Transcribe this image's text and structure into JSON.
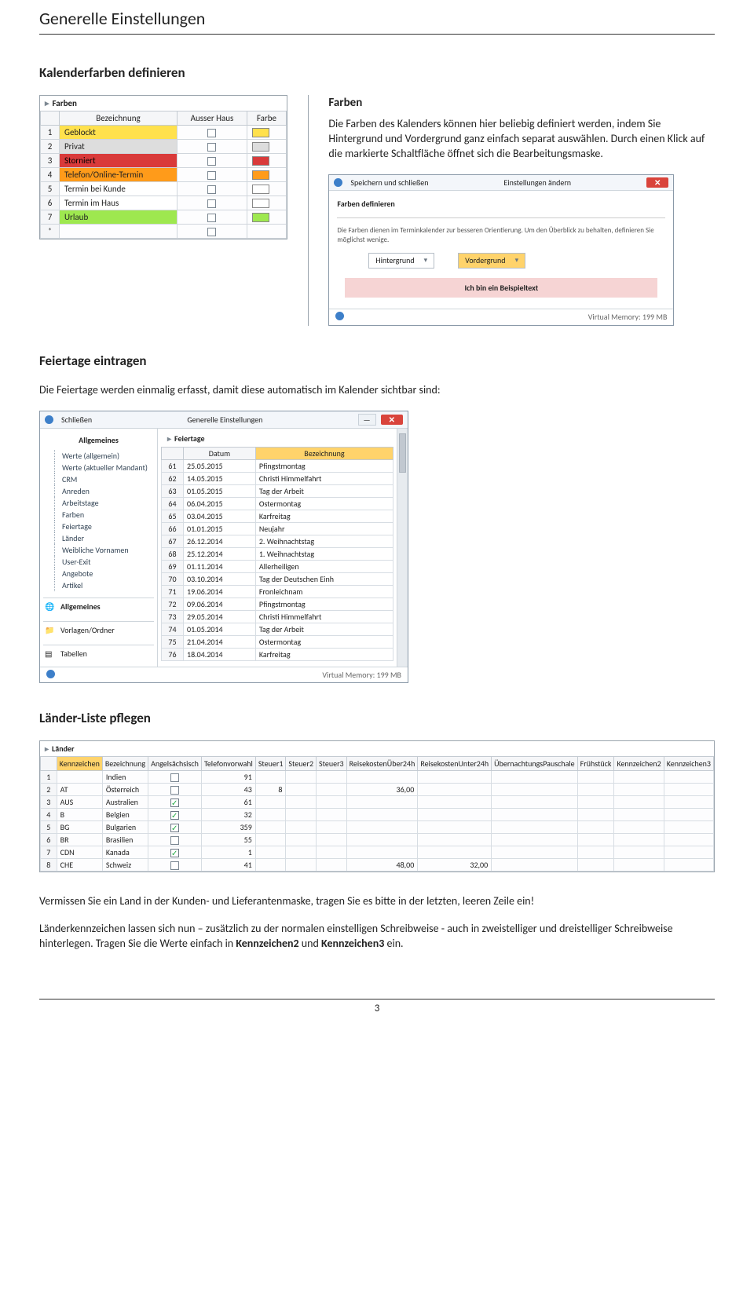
{
  "page": {
    "title": "Generelle Einstellungen",
    "footer_page": "3"
  },
  "sec_farben": {
    "heading": "Kalenderfarben definieren",
    "sub": "Farben",
    "text": "Die Farben des Kalenders können hier beliebig definiert werden, indem Sie Hintergrund und Vordergrund ganz einfach separat auswählen. Durch einen Klick auf die markierte Schaltfläche öffnet sich die Bearbeitungsmaske."
  },
  "farben_grid": {
    "caption": "Farben",
    "cols": [
      "",
      "Bezeichnung",
      "Ausser Haus",
      "Farbe"
    ],
    "rows": [
      {
        "n": "1",
        "bez": "Geblockt",
        "cls": "row-yellow"
      },
      {
        "n": "2",
        "bez": "Privat",
        "cls": "row-grey"
      },
      {
        "n": "3",
        "bez": "Storniert",
        "cls": "row-red"
      },
      {
        "n": "4",
        "bez": "Telefon/Online-Termin",
        "cls": "row-orange"
      },
      {
        "n": "5",
        "bez": "Termin bei Kunde",
        "cls": "row-white"
      },
      {
        "n": "6",
        "bez": "Termin im Haus",
        "cls": "row-white"
      },
      {
        "n": "7",
        "bez": "Urlaub",
        "cls": "row-green"
      }
    ]
  },
  "edit_dialog": {
    "save": "Speichern und schließen",
    "title": "Einstellungen ändern",
    "section": "Farben definieren",
    "hint": "Die Farben dienen im Terminkalender zur besseren Orientierung. Um den Überblick zu behalten, definieren Sie möglichst wenige.",
    "dd_hg": "Hintergrund",
    "dd_vg": "Vordergrund",
    "sample": "Ich bin ein Beispieltext",
    "mem": "Virtual Memory: 199 MB"
  },
  "sec_feier": {
    "heading": "Feiertage eintragen",
    "text": "Die Feiertage werden einmalig erfasst, damit diese automatisch im Kalender sichtbar sind:"
  },
  "feier_dialog": {
    "close": "Schließen",
    "title": "Generelle Einstellungen",
    "tree_head": "Allgemeines",
    "tree": [
      "Werte (allgemein)",
      "Werte (aktueller Mandant)",
      "CRM",
      "Anreden",
      "Arbeitstage",
      "Farben",
      "Feiertage",
      "Länder",
      "Weibliche Vornamen",
      "User-Exit",
      "Angebote",
      "Artikel"
    ],
    "sec1": "Allgemeines",
    "sec2": "Vorlagen/Ordner",
    "sec3": "Tabellen",
    "right_head": "Feiertage",
    "cols": [
      "",
      "Datum",
      "Bezeichnung"
    ],
    "rows": [
      {
        "n": "61",
        "d": "25.05.2015",
        "b": "Pfingstmontag"
      },
      {
        "n": "62",
        "d": "14.05.2015",
        "b": "Christi Himmelfahrt"
      },
      {
        "n": "63",
        "d": "01.05.2015",
        "b": "Tag der Arbeit"
      },
      {
        "n": "64",
        "d": "06.04.2015",
        "b": "Ostermontag"
      },
      {
        "n": "65",
        "d": "03.04.2015",
        "b": "Karfreitag"
      },
      {
        "n": "66",
        "d": "01.01.2015",
        "b": "Neujahr"
      },
      {
        "n": "67",
        "d": "26.12.2014",
        "b": "2. Weihnachtstag"
      },
      {
        "n": "68",
        "d": "25.12.2014",
        "b": "1. Weihnachtstag"
      },
      {
        "n": "69",
        "d": "01.11.2014",
        "b": "Allerheiligen"
      },
      {
        "n": "70",
        "d": "03.10.2014",
        "b": "Tag der Deutschen Einh"
      },
      {
        "n": "71",
        "d": "19.06.2014",
        "b": "Fronleichnam"
      },
      {
        "n": "72",
        "d": "09.06.2014",
        "b": "Pfingstmontag"
      },
      {
        "n": "73",
        "d": "29.05.2014",
        "b": "Christi Himmelfahrt"
      },
      {
        "n": "74",
        "d": "01.05.2014",
        "b": "Tag der Arbeit"
      },
      {
        "n": "75",
        "d": "21.04.2014",
        "b": "Ostermontag"
      },
      {
        "n": "76",
        "d": "18.04.2014",
        "b": "Karfreitag"
      }
    ],
    "mem": "Virtual Memory: 199 MB"
  },
  "sec_land": {
    "heading": "Länder-Liste pflegen"
  },
  "laender": {
    "caption": "Länder",
    "cols": [
      "",
      "Kennzeichen",
      "Bezeichnung",
      "Angelsächsisch",
      "Telefonvorwahl",
      "Steuer1",
      "Steuer2",
      "Steuer3",
      "ReisekostenÜber24h",
      "ReisekostenUnter24h",
      "ÜbernachtungsPauschale",
      "Frühstück",
      "Kennzeichen2",
      "Kennzeichen3"
    ],
    "rows": [
      {
        "n": "1",
        "kz": "",
        "bez": "Indien",
        "as": false,
        "tel": "91",
        "s1": "",
        "s2": "",
        "s3": "",
        "rue": "",
        "run": "",
        "up": "",
        "fs": "",
        "k2": "",
        "k3": ""
      },
      {
        "n": "2",
        "kz": "AT",
        "bez": "Österreich",
        "as": false,
        "tel": "43",
        "s1": "8",
        "s2": "",
        "s3": "",
        "rue": "36,00",
        "run": "",
        "up": "",
        "fs": "",
        "k2": "",
        "k3": ""
      },
      {
        "n": "3",
        "kz": "AUS",
        "bez": "Australien",
        "as": true,
        "tel": "61",
        "s1": "",
        "s2": "",
        "s3": "",
        "rue": "",
        "run": "",
        "up": "",
        "fs": "",
        "k2": "",
        "k3": ""
      },
      {
        "n": "4",
        "kz": "B",
        "bez": "Belgien",
        "as": true,
        "tel": "32",
        "s1": "",
        "s2": "",
        "s3": "",
        "rue": "",
        "run": "",
        "up": "",
        "fs": "",
        "k2": "",
        "k3": ""
      },
      {
        "n": "5",
        "kz": "BG",
        "bez": "Bulgarien",
        "as": true,
        "tel": "359",
        "s1": "",
        "s2": "",
        "s3": "",
        "rue": "",
        "run": "",
        "up": "",
        "fs": "",
        "k2": "",
        "k3": ""
      },
      {
        "n": "6",
        "kz": "BR",
        "bez": "Brasilien",
        "as": false,
        "tel": "55",
        "s1": "",
        "s2": "",
        "s3": "",
        "rue": "",
        "run": "",
        "up": "",
        "fs": "",
        "k2": "",
        "k3": ""
      },
      {
        "n": "7",
        "kz": "CDN",
        "bez": "Kanada",
        "as": true,
        "tel": "1",
        "s1": "",
        "s2": "",
        "s3": "",
        "rue": "",
        "run": "",
        "up": "",
        "fs": "",
        "k2": "",
        "k3": ""
      },
      {
        "n": "8",
        "kz": "CHE",
        "bez": "Schweiz",
        "as": false,
        "tel": "41",
        "s1": "",
        "s2": "",
        "s3": "",
        "rue": "48,00",
        "run": "32,00",
        "up": "",
        "fs": "",
        "k2": "",
        "k3": ""
      }
    ]
  },
  "tail": {
    "p1": "Vermissen Sie ein Land in der Kunden- und Lieferantenmaske, tragen Sie es bitte in der letzten, leeren Zeile ein!",
    "p2a": "Länderkennzeichen lassen sich nun – zusätzlich zu der normalen einstelligen Schreibweise - auch in zweistelliger und dreistelliger Schreibweise hinterlegen. Tragen Sie die Werte einfach in ",
    "p2b": "Kennzeichen2",
    "p2c": " und ",
    "p2d": "Kennzeichen3",
    "p2e": " ein."
  }
}
